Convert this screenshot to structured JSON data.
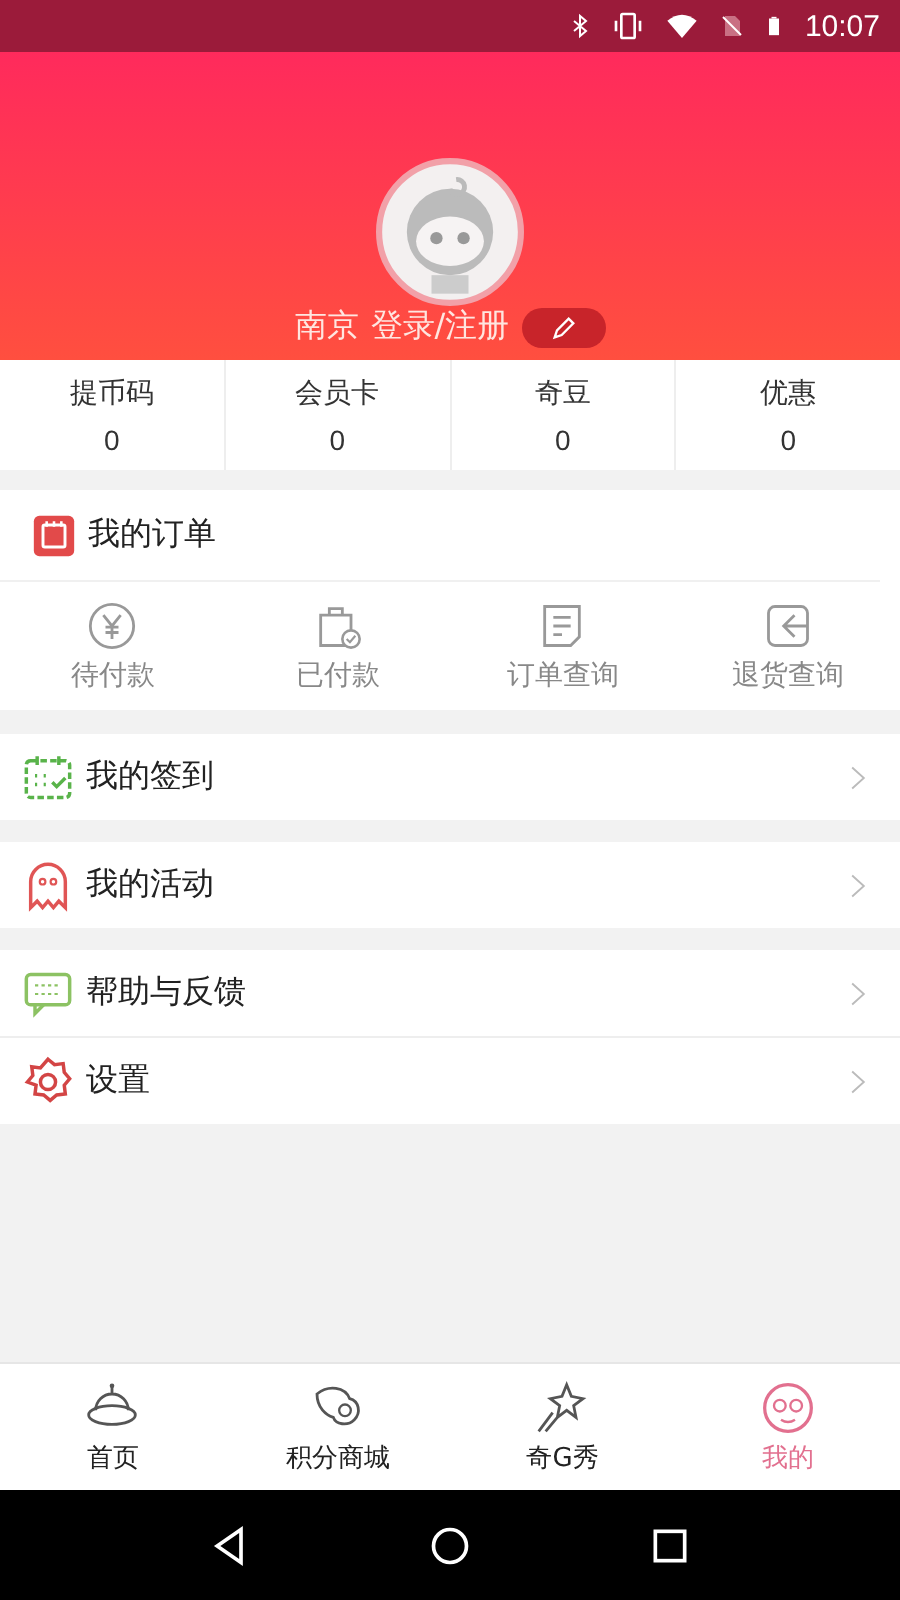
{
  "status_bar": {
    "time": "10:07"
  },
  "profile": {
    "city": "南京",
    "login": "登录/注册"
  },
  "stats": [
    {
      "label": "提币码",
      "value": "0"
    },
    {
      "label": "会员卡",
      "value": "0"
    },
    {
      "label": "奇豆",
      "value": "0"
    },
    {
      "label": "优惠",
      "value": "0"
    }
  ],
  "orders": {
    "title": "我的订单",
    "items": [
      {
        "kind": "yen",
        "label": "待付款"
      },
      {
        "kind": "bag",
        "label": "已付款"
      },
      {
        "kind": "list",
        "label": "订单查询"
      },
      {
        "kind": "return",
        "label": "退货查询"
      }
    ]
  },
  "menu_groups": [
    [
      {
        "kind": "calendar",
        "label": "我的签到"
      }
    ],
    [
      {
        "kind": "ghost",
        "label": "我的活动"
      }
    ],
    [
      {
        "kind": "chat",
        "label": "帮助与反馈"
      },
      {
        "kind": "gear",
        "label": "设置"
      }
    ]
  ],
  "tabs": [
    {
      "kind": "ufo",
      "label": "首页",
      "selected": false
    },
    {
      "kind": "wings",
      "label": "积分商城",
      "selected": false
    },
    {
      "kind": "star",
      "label": "奇G秀",
      "selected": false
    },
    {
      "kind": "face",
      "label": "我的",
      "selected": true
    }
  ]
}
